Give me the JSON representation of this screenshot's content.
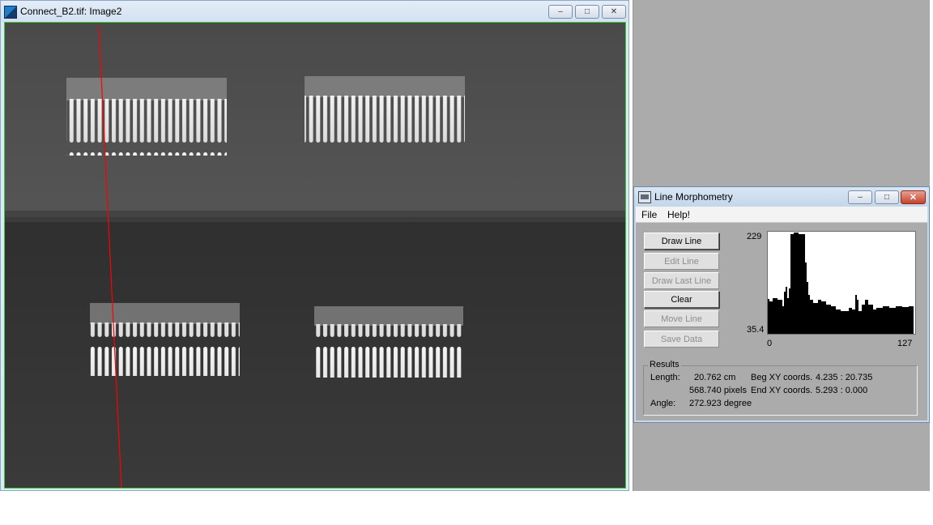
{
  "image_window": {
    "title": "Connect_B2.tif: Image2",
    "controls": {
      "minimize": "–",
      "maximize": "□",
      "close": "✕"
    },
    "icon": "app-icon"
  },
  "dialog": {
    "title": "Line Morphometry",
    "icon": "window-icon",
    "controls": {
      "minimize": "–",
      "maximize": "□",
      "close": "✕"
    },
    "menu": [
      "File",
      "Help!"
    ],
    "buttons": [
      {
        "label": "Draw Line",
        "enabled": true
      },
      {
        "label": "Edit Line",
        "enabled": false
      },
      {
        "label": "Draw Last Line",
        "enabled": false
      },
      {
        "label": "Clear",
        "enabled": true
      },
      {
        "label": "Move Line",
        "enabled": false
      },
      {
        "label": "Save Data",
        "enabled": false
      }
    ],
    "histogram": {
      "y_max_label": "229",
      "y_min_label": "35.4",
      "x_min_label": "0",
      "x_max_label": "127"
    },
    "results": {
      "legend": "Results",
      "length_label": "Length:",
      "length_cm": "20.762 cm",
      "length_pixels": "568.740 pixels",
      "angle_label": "Angle:",
      "angle_value": "272.923 degree",
      "beg_label": "Beg XY coords.",
      "beg_value": "4.235 : 20.735",
      "end_label": "End XY coords.",
      "end_value": "5.293 : 0.000"
    }
  },
  "colors": {
    "profile_line": "#ff0000",
    "canvas_border": "#31d031",
    "close_button": "#c4432c"
  }
}
